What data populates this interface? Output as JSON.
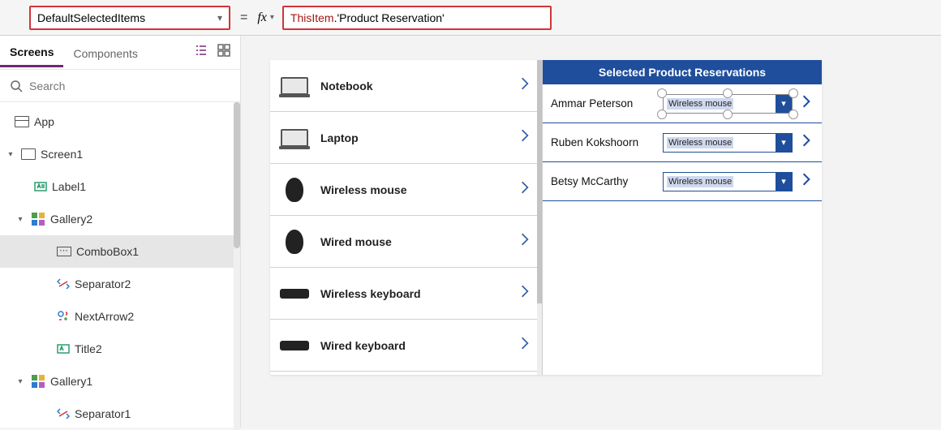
{
  "formula_bar": {
    "property": "DefaultSelectedItems",
    "equals": "=",
    "fx": "fx",
    "expr_this": "ThisItem",
    "expr_dot": ".",
    "expr_str": "'Product Reservation'"
  },
  "tabs": {
    "screens": "Screens",
    "components": "Components"
  },
  "search": {
    "placeholder": "Search"
  },
  "tree": {
    "app": "App",
    "screen1": "Screen1",
    "label1": "Label1",
    "gallery2": "Gallery2",
    "combobox1": "ComboBox1",
    "separator2": "Separator2",
    "nextarrow2": "NextArrow2",
    "title2": "Title2",
    "gallery1": "Gallery1",
    "separator1": "Separator1"
  },
  "products": [
    {
      "label": "Notebook"
    },
    {
      "label": "Laptop"
    },
    {
      "label": "Wireless mouse"
    },
    {
      "label": "Wired mouse"
    },
    {
      "label": "Wireless keyboard"
    },
    {
      "label": "Wired keyboard"
    }
  ],
  "reservations": {
    "header": "Selected Product Reservations",
    "rows": [
      {
        "name": "Ammar Peterson",
        "tag": "Wireless mouse"
      },
      {
        "name": "Ruben Kokshoorn",
        "tag": "Wireless mouse"
      },
      {
        "name": "Betsy McCarthy",
        "tag": "Wireless mouse"
      }
    ]
  }
}
